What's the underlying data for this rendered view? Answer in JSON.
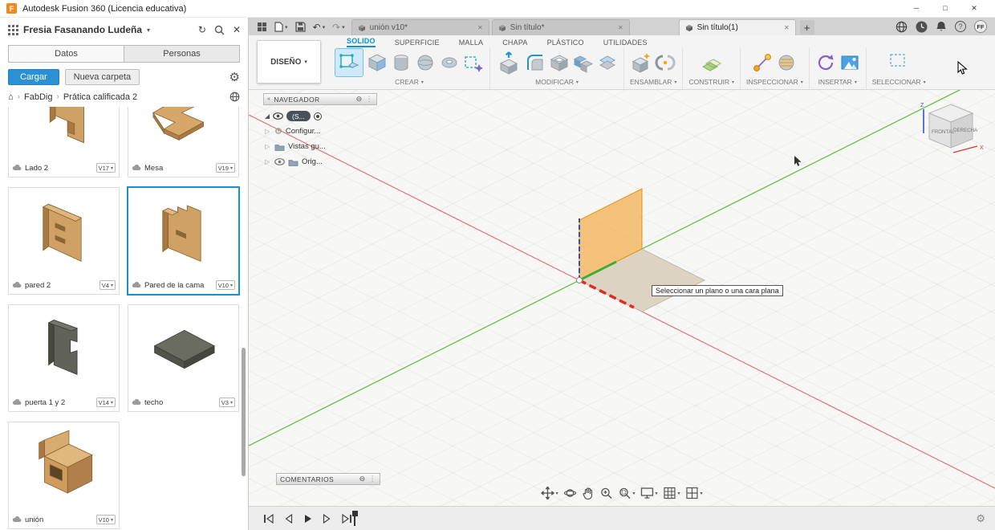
{
  "icons": {
    "logo": "F",
    "chevron_down": "▾",
    "window_minimize": "─",
    "window_maximize": "□",
    "window_close": "✕",
    "close": "✕",
    "refresh": "↻",
    "gear": "⚙",
    "home": "⌂",
    "breadcrumb_sep": "›",
    "undo": "↶",
    "redo": "↷",
    "add_tab": "+",
    "question": "?",
    "collapse": "«",
    "minimize_panel": "⊖",
    "drag_handle": "⋮",
    "expand_closed": "▷"
  },
  "titlebar": {
    "title": "Autodesk Fusion 360 (Licencia educativa)"
  },
  "datapanel": {
    "user_name": "Fresia Fasanando Ludeña",
    "tab_datos": "Datos",
    "tab_personas": "Personas",
    "upload": "Cargar",
    "new_folder": "Nueva carpeta",
    "breadcrumb_root": "FabDig",
    "breadcrumb_current": "Prática calificada 2",
    "items": [
      {
        "name": "Lado 2",
        "version": "V17"
      },
      {
        "name": "Mesa",
        "version": "V19"
      },
      {
        "name": "pared 2",
        "version": "V4"
      },
      {
        "name": "Pared de la cama",
        "version": "V10"
      },
      {
        "name": "puerta 1 y 2",
        "version": "V14"
      },
      {
        "name": "techo",
        "version": "V3"
      },
      {
        "name": "unión",
        "version": "V10"
      }
    ]
  },
  "tabbar": {
    "documents": [
      {
        "label": "unión v10*"
      },
      {
        "label": "Sin título*"
      },
      {
        "label": "Sin título(1)"
      }
    ],
    "avatar_initials": "FF"
  },
  "ribbon": {
    "workspace": "DISEÑO",
    "env_tabs": [
      {
        "label": "SOLIDO"
      },
      {
        "label": "SUPERFICIE"
      },
      {
        "label": "MALLA"
      },
      {
        "label": "CHAPA"
      },
      {
        "label": "PLÁSTICO"
      },
      {
        "label": "UTILIDADES"
      }
    ],
    "groups": [
      {
        "label": "CREAR"
      },
      {
        "label": "MODIFICAR"
      },
      {
        "label": "ENSAMBLAR"
      },
      {
        "label": "CONSTRUIR"
      },
      {
        "label": "INSPECCIONAR"
      },
      {
        "label": "INSERTAR"
      },
      {
        "label": "SELECCIONAR"
      }
    ]
  },
  "canvas": {
    "navigator": {
      "title": "NAVEGADOR",
      "root_label": "(S...",
      "rows": [
        {
          "label": "Configur..."
        },
        {
          "label": "Vistas gu..."
        },
        {
          "label": "Orig..."
        }
      ]
    },
    "comments_title": "COMENTARIOS",
    "tooltip": "Seleccionar un plano o una cara plana",
    "viewcube": {
      "front": "FRONTAL",
      "right": "DERECHA",
      "z": "Z",
      "x": "X"
    }
  },
  "colors": {
    "accent_blue": "#0696d7",
    "axis_green": "#6cc04a",
    "axis_red": "#e8534a",
    "axis_blue": "#2b50d8",
    "plane_orange": "#f0a22e",
    "plane_tan": "#ddd3c2",
    "wood": "#cf9c5e",
    "dark_part": "#5f6157"
  }
}
